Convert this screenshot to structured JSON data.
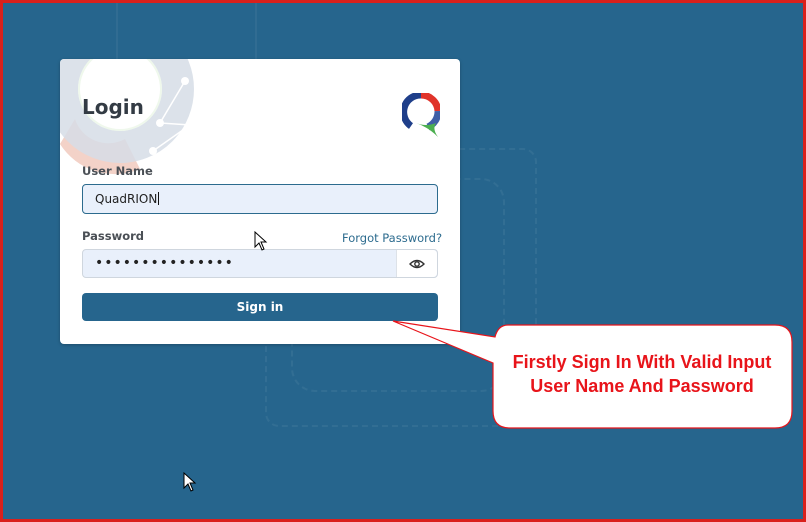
{
  "login": {
    "title": "Login",
    "username_label": "User Name",
    "username_value": "QuadRION",
    "password_label": "Password",
    "password_mask": "•••••••••••••••",
    "forgot_link": "Forgot Password?",
    "signin_label": "Sign in",
    "eye_icon": "eye-icon",
    "logo_icon": "quadrion-q-logo"
  },
  "callout": {
    "line1": "Firstly Sign In With Valid Input",
    "line2": "User Name And Password"
  },
  "colors": {
    "background": "#26658d",
    "frame_border": "#d9201c",
    "accent": "#26658d",
    "callout_text": "#e8141a",
    "callout_border": "#e8141a",
    "input_background": "#e9f0fb"
  }
}
